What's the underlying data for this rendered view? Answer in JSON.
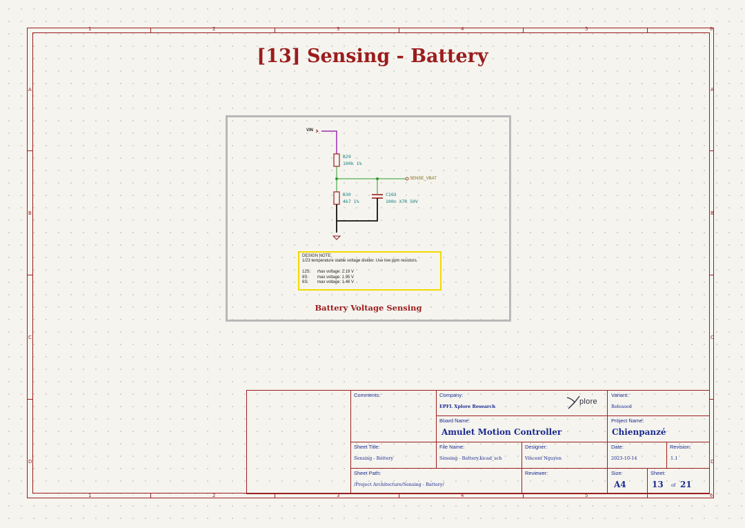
{
  "sheet": {
    "title": "[13] Sensing - Battery",
    "column_numbers": [
      "1",
      "2",
      "3",
      "4",
      "5",
      "6"
    ],
    "row_letters": [
      "A",
      "B",
      "C",
      "D"
    ]
  },
  "schematic": {
    "group_title": "Battery Voltage Sensing",
    "power_net": "VIN",
    "label_net": "SENSE_VBAT",
    "components": [
      {
        "ref": "R29",
        "value": "100k 1%"
      },
      {
        "ref": "R30",
        "value": "4k7 1%"
      },
      {
        "ref": "C103",
        "value": "100n X7R 50V"
      }
    ],
    "note": {
      "header": "DESIGN NOTE:",
      "line1": "1/23 temperature stable voltage divider. Use low ppm resistors.",
      "rows": [
        {
          "cells": "12S:",
          "label": "max voltage: 2.19 V"
        },
        {
          "cells": "8S:",
          "label": "max voltage: 1.95 V"
        },
        {
          "cells": "6S:",
          "label": "max voltage: 1.46 V"
        }
      ]
    }
  },
  "title_block": {
    "comments_label": "Comments:",
    "company_label": "Company:",
    "company": "EPFL Xplore Research",
    "logo_text": "plore",
    "variant_label": "Variant:",
    "variant": "Released",
    "board_name_label": "Board Name:",
    "board_name": "Amulet Motion Controller",
    "project_name_label": "Project Name:",
    "project_name": "Chienpanzé",
    "sheet_title_label": "Sheet Title:",
    "sheet_title": "Sensing - Battery",
    "file_name_label": "File Name:",
    "file_name": "Sensing - Battery.kicad_sch",
    "designer_label": "Designer:",
    "designer": "Vincent Nguyen",
    "date_label": "Date:",
    "date": "2023-10-14",
    "revision_label": "Revision:",
    "revision": "1.1",
    "sheet_path_label": "Sheet Path:",
    "sheet_path": "/Project Architecture/Sensing - Battery/",
    "reviewer_label": "Reviewer:",
    "size_label": "Size:",
    "size": "A4",
    "sheet_label": "Sheet:",
    "sheet_number": "13",
    "of_label": "of",
    "sheet_total": "21"
  },
  "colors": {
    "frame": "#9b1c1c",
    "title_block_text": "#1a2b8f",
    "wire": "#2a9d2a",
    "power_wire": "#9b2bb0",
    "component_text": "#0f7f7f",
    "note_border": "#f2d900",
    "group_border": "#b8b8b8"
  }
}
